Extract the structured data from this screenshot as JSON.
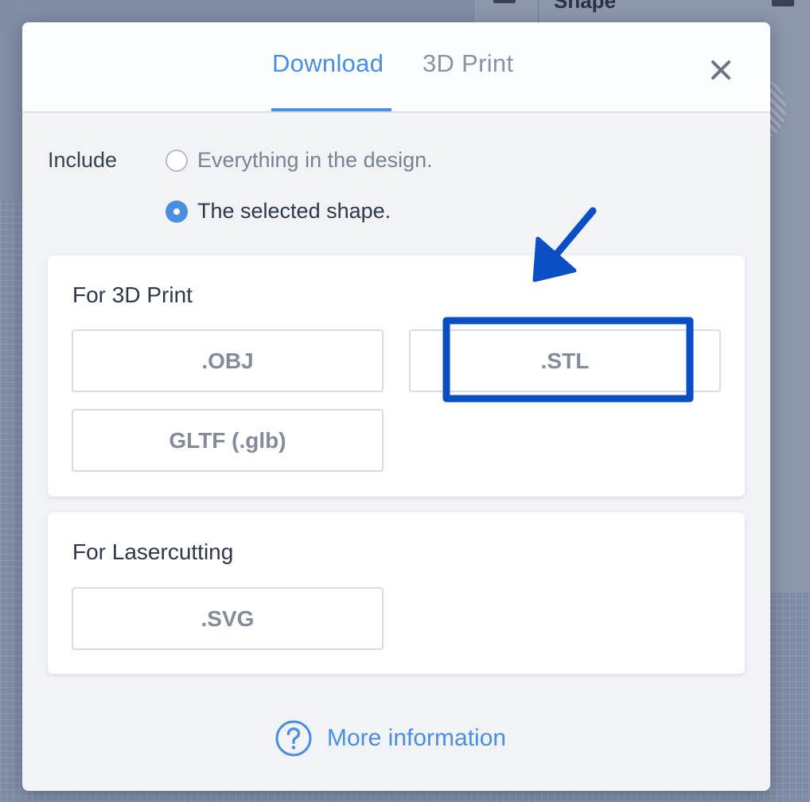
{
  "background": {
    "panel_title": "Shape"
  },
  "tabs": [
    {
      "label": "Download",
      "active": true
    },
    {
      "label": "3D Print",
      "active": false
    }
  ],
  "include": {
    "label": "Include",
    "options": [
      {
        "label": "Everything in the design.",
        "checked": false
      },
      {
        "label": "The selected shape.",
        "checked": true
      }
    ]
  },
  "print_section": {
    "title": "For 3D Print",
    "buttons": [
      ".OBJ",
      ".STL",
      "GLTF (.glb)"
    ]
  },
  "laser_section": {
    "title": "For Lasercutting",
    "buttons": [
      ".SVG"
    ]
  },
  "more_info": {
    "label": "More information"
  },
  "colors": {
    "accent": "#4a8ee0",
    "annotation": "#0a4fc4"
  },
  "icons": {
    "close": "close-icon",
    "help": "help-circle-icon"
  }
}
